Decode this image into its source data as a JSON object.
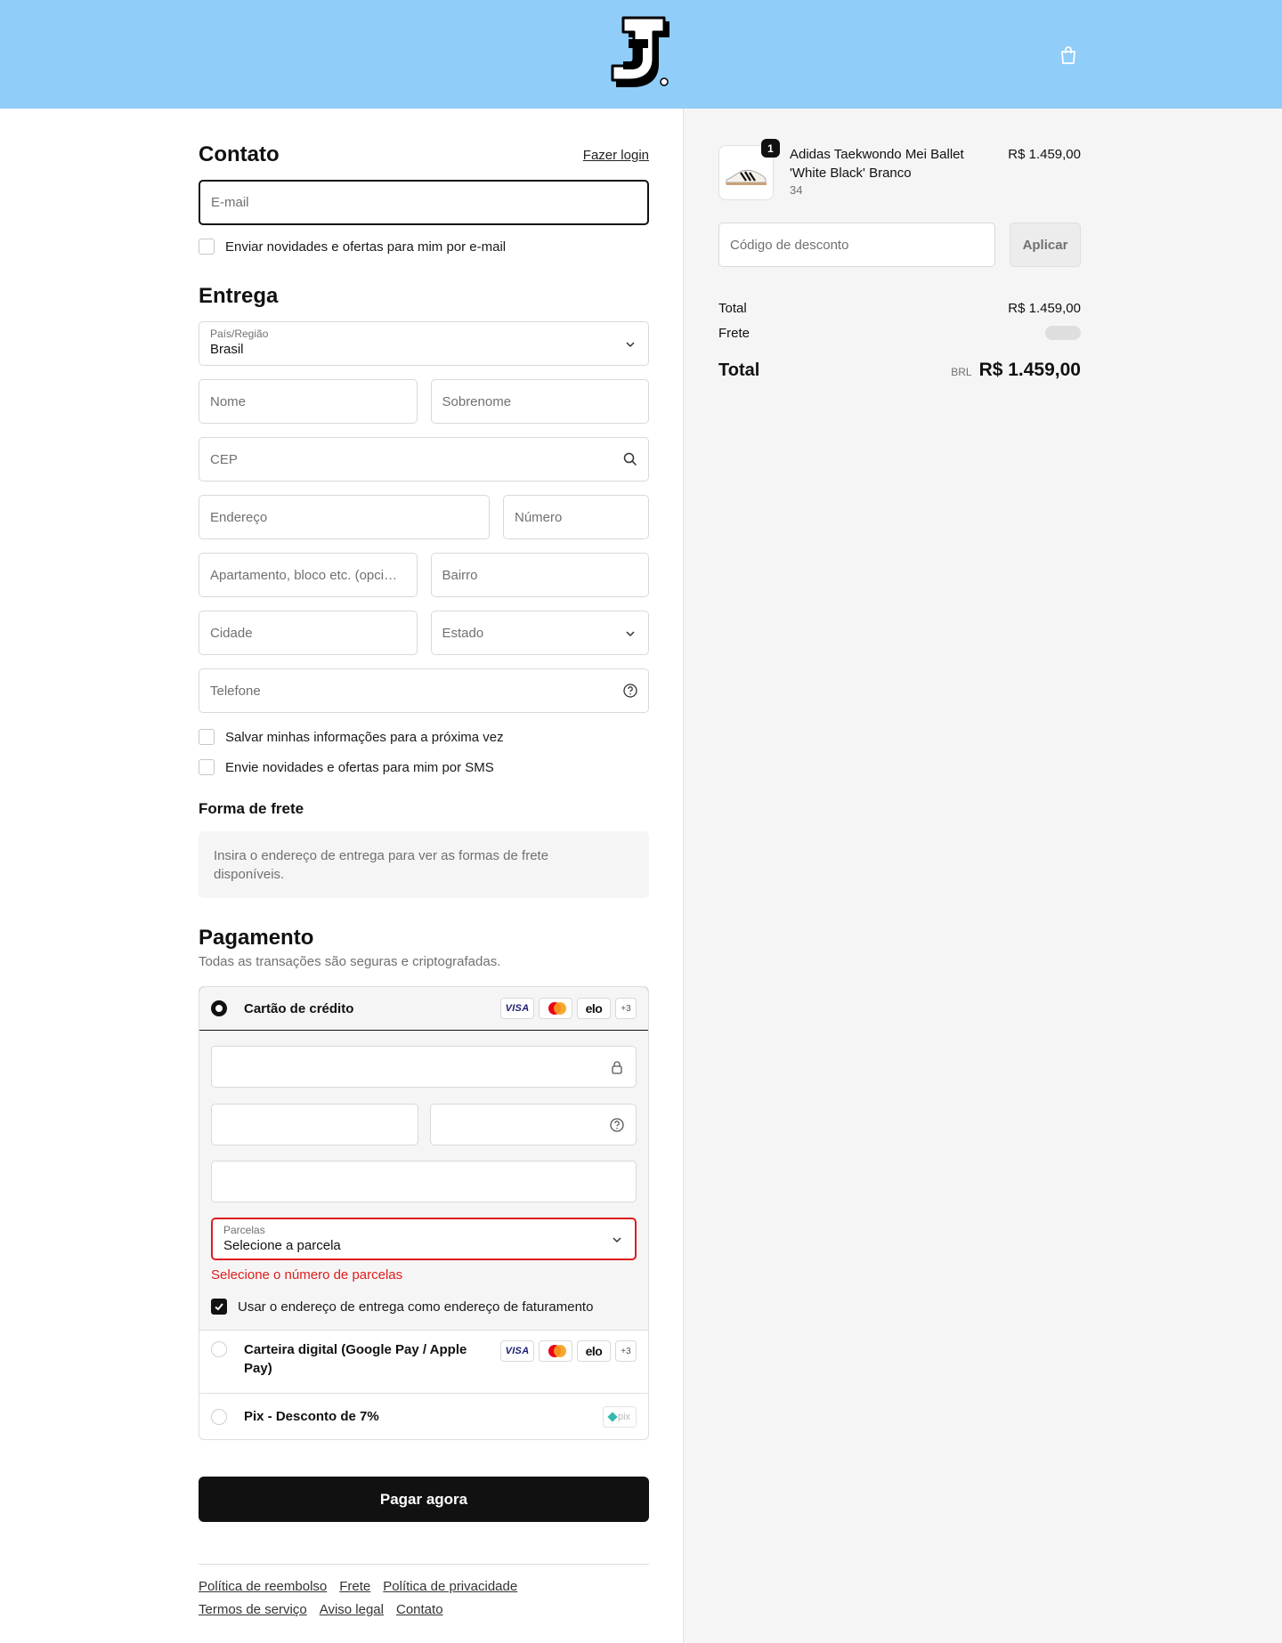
{
  "header": {
    "logo_icon": "brand-logo",
    "cart_icon": "shopping-bag-icon"
  },
  "contact": {
    "title": "Contato",
    "login_link": "Fazer login",
    "email_placeholder": "E-mail",
    "newsletter_label": "Enviar novidades e ofertas para mim por e-mail",
    "newsletter_checked": false
  },
  "delivery": {
    "title": "Entrega",
    "country_label": "País/Região",
    "country_value": "Brasil",
    "first_name_placeholder": "Nome",
    "last_name_placeholder": "Sobrenome",
    "cep_placeholder": "CEP",
    "address_placeholder": "Endereço",
    "number_placeholder": "Número",
    "complement_placeholder": "Apartamento, bloco etc. (opci…",
    "neighborhood_placeholder": "Bairro",
    "city_placeholder": "Cidade",
    "state_placeholder": "Estado",
    "phone_placeholder": "Telefone",
    "save_info_label": "Salvar minhas informações para a próxima vez",
    "save_info_checked": false,
    "sms_label": "Envie novidades e ofertas para mim por SMS",
    "sms_checked": false
  },
  "shipping": {
    "title": "Forma de frete",
    "message": "Insira o endereço de entrega para ver as formas de frete disponíveis."
  },
  "payment": {
    "title": "Pagamento",
    "subtitle": "Todas as transações são seguras e criptografadas.",
    "card": {
      "label": "Cartão de crédito",
      "selected": true,
      "brands": [
        {
          "label": "VISA"
        },
        {
          "icon": "mastercard-icon"
        },
        {
          "label": "elo"
        },
        {
          "label": "+3"
        }
      ],
      "number_icon": "lock-icon",
      "cvv_icon": "help-circle-icon",
      "installments_label": "Parcelas",
      "installments_value": "Selecione a parcela",
      "installments_error": "Selecione o número de parcelas",
      "billing_same_label": "Usar o endereço de entrega como endereço de faturamento",
      "billing_same_checked": true
    },
    "wallet": {
      "label": "Carteira digital (Google Pay / Apple Pay)",
      "selected": false,
      "brands": [
        {
          "label": "VISA"
        },
        {
          "icon": "mastercard-icon"
        },
        {
          "label": "elo"
        },
        {
          "label": "+3"
        }
      ]
    },
    "pix": {
      "label": "Pix - Desconto de 7%",
      "selected": false,
      "logo_text": "pix"
    }
  },
  "pay_button": "Pagar agora",
  "footer": {
    "links": [
      "Política de reembolso",
      "Frete",
      "Política de privacidade",
      "Termos de serviço",
      "Aviso legal",
      "Contato"
    ]
  },
  "order": {
    "item": {
      "name": "Adidas Taekwondo Mei Ballet 'White Black' Branco",
      "variant": "34",
      "quantity": "1",
      "price": "R$ 1.459,00"
    },
    "discount_placeholder": "Código de desconto",
    "apply_label": "Aplicar",
    "subtotal_label": "Total",
    "subtotal_value": "R$ 1.459,00",
    "shipping_label": "Frete",
    "total_label": "Total",
    "currency": "BRL",
    "total_value": "R$ 1.459,00"
  },
  "colors": {
    "header_background": "#90CDF9",
    "accent": "#111111",
    "error": "#DD1D1D",
    "summary_panel": "#F5F5F5",
    "pix": "#32BCAD"
  }
}
